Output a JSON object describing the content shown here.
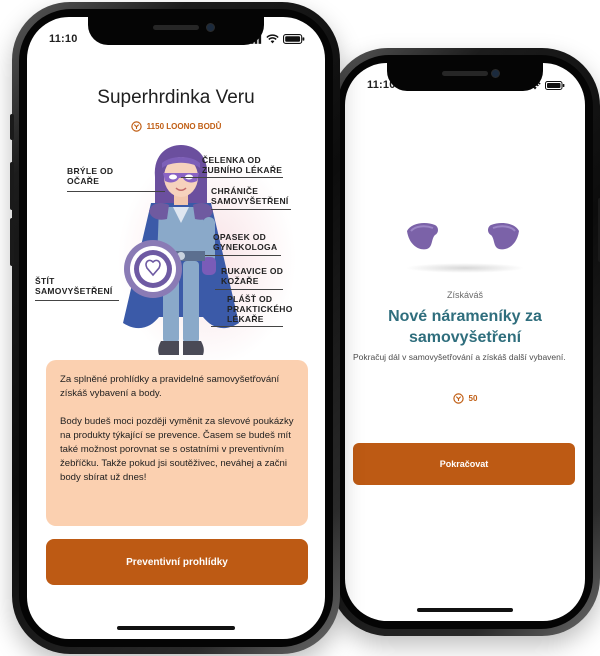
{
  "left_screen": {
    "status_time": "11:10",
    "title": "Superhrdinka Veru",
    "points": "1150 LOONO BODŮ",
    "labels": {
      "glasses": [
        "BRÝLE OD",
        "OČAŘE"
      ],
      "headband": [
        "ČELENKA OD",
        "ZUBNÍHO LÉKAŘE"
      ],
      "shoulder_guards": [
        "CHRÁNIČE",
        "SAMOVYŠETŘENÍ"
      ],
      "belt": [
        "OPASEK OD",
        "GYNEKOLOGA"
      ],
      "gloves": [
        "RUKAVICE OD",
        "KOŽAŘE"
      ],
      "shield": [
        "ŠTÍT",
        "SAMOVYŠETŘENÍ"
      ],
      "cape": [
        "PLÁŠŤ OD",
        "PRAKTICKÉHO",
        "LÉKAŘE"
      ]
    },
    "info_paragraph_1": "Za splněné prohlídky a pravidelné samovyšetřování získáš vybavení a body.",
    "info_paragraph_2": "Body budeš moci později vyměnit za slevové poukázky na produkty týkající se prevence. Časem se budeš mít také možnost porovnat se s ostatními v preventivním žebříčku. Takže pokud jsi soutěživec, neváhej a začni body sbírat už dnes!",
    "button_label": "Preventivní prohlídky"
  },
  "right_screen": {
    "status_time": "11:10",
    "gain_label": "Získáváš",
    "gain_title": "Nové nárameníky za samovyšetření",
    "gain_text": "Pokračuj dál v samovyšetřování a získáš další vybavení.",
    "points": "50",
    "button_label": "Pokračovat"
  },
  "colors": {
    "accent_orange": "#bd5a14",
    "card_peach": "#fbd0b0",
    "title_teal": "#2f6e7d",
    "reward_purple": "#7b62a8"
  },
  "icons": {
    "points": "loono-coin-icon",
    "signal": "signal-icon",
    "wifi": "wifi-icon",
    "battery": "battery-icon"
  }
}
